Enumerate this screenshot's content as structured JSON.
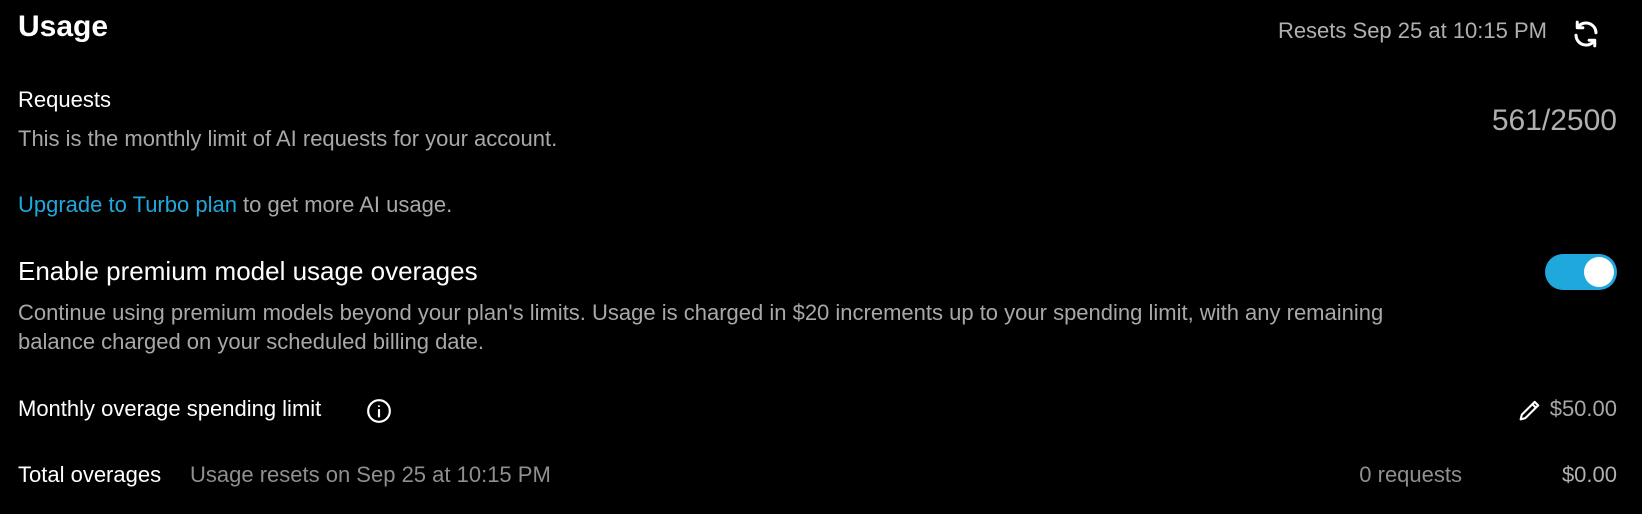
{
  "header": {
    "title": "Usage",
    "resets_text": "Resets Sep 25 at 10:15 PM",
    "refresh_icon": "refresh-icon"
  },
  "requests": {
    "title": "Requests",
    "description": "This is the monthly limit of AI requests for your account.",
    "count": "561/2500"
  },
  "upgrade": {
    "link_text": "Upgrade to Turbo plan",
    "rest_text": " to get more AI usage."
  },
  "overages": {
    "title": "Enable premium model usage overages",
    "description": "Continue using premium models beyond your plan's limits. Usage is charged in $20 increments up to your spending limit, with any remaining balance charged on your scheduled billing date.",
    "enabled": true
  },
  "spending_limit": {
    "label": "Monthly overage spending limit",
    "info_icon": "info-icon",
    "edit_icon": "pencil-icon",
    "value": "$50.00"
  },
  "total_overages": {
    "label": "Total overages",
    "reset_text": "Usage resets on Sep 25 at 10:15 PM",
    "requests": "0 requests",
    "amount": "$0.00"
  },
  "colors": {
    "background": "#000000",
    "accent": "#1fa8dc",
    "text_primary": "#ffffff",
    "text_secondary": "#a8a8a8"
  }
}
